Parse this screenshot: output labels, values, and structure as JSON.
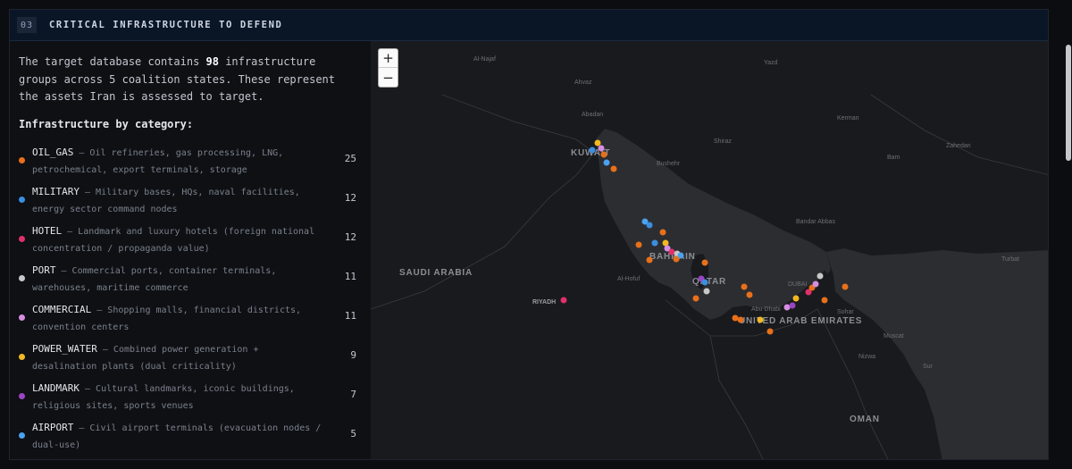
{
  "header": {
    "number": "03",
    "title": "CRITICAL INFRASTRUCTURE TO DEFEND"
  },
  "intro": {
    "before": "The target database contains ",
    "groups_count": "98",
    "after": " infrastructure groups across 5 coalition states. These represent the assets Iran is assessed to target."
  },
  "category_heading": "Infrastructure by category:",
  "categories": [
    {
      "name": "OIL_GAS",
      "desc": " — Oil refineries, gas processing, LNG, petrochemical, export terminals, storage",
      "count": "25",
      "color": "#e8701a"
    },
    {
      "name": "MILITARY",
      "desc": " — Military bases, HQs, naval facilities, energy sector command nodes",
      "count": "12",
      "color": "#3b8ee0"
    },
    {
      "name": "HOTEL",
      "desc": " — Landmark and luxury hotels (foreign national concentration / propaganda value)",
      "count": "12",
      "color": "#e0306a"
    },
    {
      "name": "PORT",
      "desc": " — Commercial ports, container terminals, warehouses, maritime commerce",
      "count": "11",
      "color": "#c8c8c8"
    },
    {
      "name": "COMMERCIAL",
      "desc": " — Shopping malls, financial districts, convention centers",
      "count": "11",
      "color": "#d58ee0"
    },
    {
      "name": "POWER_WATER",
      "desc": " — Combined power generation + desalination plants (dual criticality)",
      "count": "9",
      "color": "#f2b822"
    },
    {
      "name": "LANDMARK",
      "desc": " — Cultural landmarks, iconic buildings, religious sites, sports venues",
      "count": "7",
      "color": "#9b45c4"
    },
    {
      "name": "AIRPORT",
      "desc": " — Civil airport terminals (evacuation nodes / dual-use)",
      "count": "5",
      "color": "#4aa2f0"
    }
  ],
  "map": {
    "zoom_in": "+",
    "zoom_out": "−",
    "labels": [
      {
        "text": "Al-Najaf",
        "kind": "city"
      },
      {
        "text": "Yazd",
        "kind": "city"
      },
      {
        "text": "Ahvaz",
        "kind": "city"
      },
      {
        "text": "Abadan",
        "kind": "city"
      },
      {
        "text": "Kerman",
        "kind": "city"
      },
      {
        "text": "Shiraz",
        "kind": "city"
      },
      {
        "text": "Bushehr",
        "kind": "city"
      },
      {
        "text": "Bam",
        "kind": "city"
      },
      {
        "text": "Zahedan",
        "kind": "city"
      },
      {
        "text": "KUWAIT",
        "kind": "country"
      },
      {
        "text": "Bandar Abbas",
        "kind": "city"
      },
      {
        "text": "SAUDI ARABIA",
        "kind": "country"
      },
      {
        "text": "BAHRAIN",
        "kind": "country"
      },
      {
        "text": "Al-Hofuf",
        "kind": "city"
      },
      {
        "text": "QATAR",
        "kind": "country"
      },
      {
        "text": "RIYADH",
        "kind": "capital"
      },
      {
        "text": "DUBAI",
        "kind": "city"
      },
      {
        "text": "Sohar",
        "kind": "city"
      },
      {
        "text": "Abu Dhabi",
        "kind": "city"
      },
      {
        "text": "UNITED ARAB EMIRATES",
        "kind": "country"
      },
      {
        "text": "Muscat",
        "kind": "city"
      },
      {
        "text": "Nizwa",
        "kind": "city"
      },
      {
        "text": "Turbat",
        "kind": "city"
      },
      {
        "text": "Sur",
        "kind": "city"
      },
      {
        "text": "OMAN",
        "kind": "country"
      }
    ]
  }
}
